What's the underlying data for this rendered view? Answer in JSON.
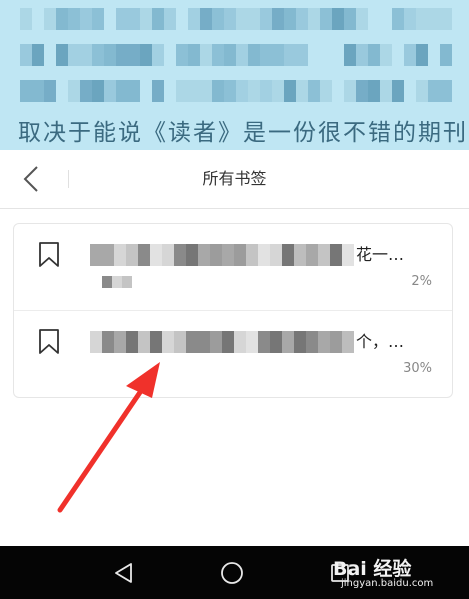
{
  "book": {
    "last_line_text": "取决于能说《读者》是一份很不错的期刊，是一份"
  },
  "header": {
    "title": "所有书签"
  },
  "bookmarks": [
    {
      "visible_tail": "花一…",
      "percent": "2%"
    },
    {
      "visible_tail": "个，…",
      "percent": "30%"
    }
  ],
  "watermark": {
    "brand": "Bai 经验",
    "url": "jingyan.baidu.com"
  },
  "colors": {
    "book_bg": "#bfe6f3",
    "arrow": "#f0312b",
    "nav_bg": "#050505"
  },
  "icons": {
    "back": "chevron-left-icon",
    "bookmark": "bookmark-icon",
    "nav_back": "triangle-back-icon",
    "nav_home": "circle-home-icon",
    "nav_recent": "square-recent-icon"
  }
}
